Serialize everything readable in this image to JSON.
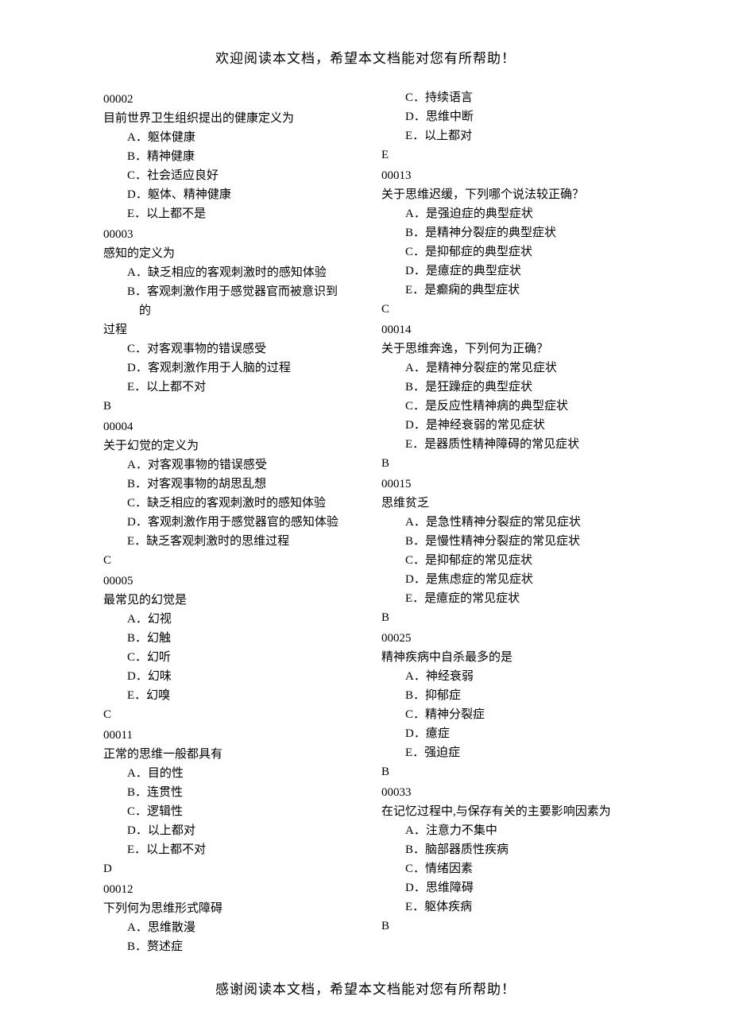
{
  "header": "欢迎阅读本文档，希望本文档能对您有所帮助！",
  "footer": "感谢阅读本文档，希望本文档能对您有所帮助！",
  "left": {
    "q1": {
      "id": "00002",
      "stem": "目前世界卫生组织提出的健康定义为",
      "A": "躯体健康",
      "B": "精神健康",
      "C": "社会适应良好",
      "D": "躯体、精神健康",
      "E": "以上都不是"
    },
    "q2": {
      "id": "00003",
      "stem": "感知的定义为",
      "A": "缺乏相应的客观刺激时的感知体验",
      "B": "客观刺激作用于感觉器官而被意识到的",
      "B2": "过程",
      "C": "对客观事物的错误感受",
      "D": "客观刺激作用于人脑的过程",
      "E": "以上都不对",
      "ans": "B"
    },
    "q3": {
      "id": "00004",
      "stem": "关于幻觉的定义为",
      "A": "对客观事物的错误感受",
      "B": "对客观事物的胡思乱想",
      "C": "缺乏相应的客观刺激时的感知体验",
      "D": "客观刺激作用于感觉器官的感知体验",
      "E": "缺乏客观刺激时的思维过程",
      "ans": "C"
    },
    "q4": {
      "id": "00005",
      "stem": "最常见的幻觉是",
      "A": "幻视",
      "B": "幻触",
      "C": "幻听",
      "D": "幻味",
      "E": "幻嗅",
      "ans": "C"
    },
    "q5": {
      "id": "00011",
      "stem": "正常的思维一般都具有",
      "A": "目的性",
      "B": "连贯性",
      "C": "逻辑性",
      "D": "以上都对",
      "E": "以上都不对",
      "ans": "D"
    },
    "q6": {
      "id": "00012",
      "stem": "下列何为思维形式障碍",
      "A": "思维散漫",
      "B": "赘述症"
    }
  },
  "right": {
    "q6tail": {
      "C": "持续语言",
      "D": "思维中断",
      "E": "以上都对",
      "ans": "E"
    },
    "q7": {
      "id": "00013",
      "stem": "关于思维迟缓，下列哪个说法较正确？",
      "A": "是强迫症的典型症状",
      "B": "是精神分裂症的典型症状",
      "C": "是抑郁症的典型症状",
      "D": "是癔症的典型症状",
      "E": "是癫痫的典型症状",
      "ans": "C"
    },
    "q8": {
      "id": "00014",
      "stem": "关于思维奔逸，下列何为正确？",
      "A": "是精神分裂症的常见症状",
      "B": "是狂躁症的典型症状",
      "C": "是反应性精神病的典型症状",
      "D": "是神经衰弱的常见症状",
      "E": "是器质性精神障碍的常见症状",
      "ans": "B"
    },
    "q9": {
      "id": "00015",
      "stem": "思维贫乏",
      "A": "是急性精神分裂症的常见症状",
      "B": "是慢性精神分裂症的常见症状",
      "C": "是抑郁症的常见症状",
      "D": "是焦虑症的常见症状",
      "E": "是癔症的常见症状",
      "ans": "B"
    },
    "q10": {
      "id": "00025",
      "stem": "精神疾病中自杀最多的是",
      "A": "神经衰弱",
      "B": "抑郁症",
      "C": "精神分裂症",
      "D": "癔症",
      "E": "强迫症",
      "ans": "B"
    },
    "q11": {
      "id": "00033",
      "stem": "在记忆过程中,与保存有关的主要影响因素为",
      "A": "注意力不集中",
      "B": "脑部器质性疾病",
      "C": "情绪因素",
      "D": "思维障碍",
      "E": "躯体疾病",
      "ans": "B"
    }
  },
  "labels": {
    "A": "A．",
    "B": "B．",
    "C": "C．",
    "D": "D．",
    "E": "E．"
  }
}
